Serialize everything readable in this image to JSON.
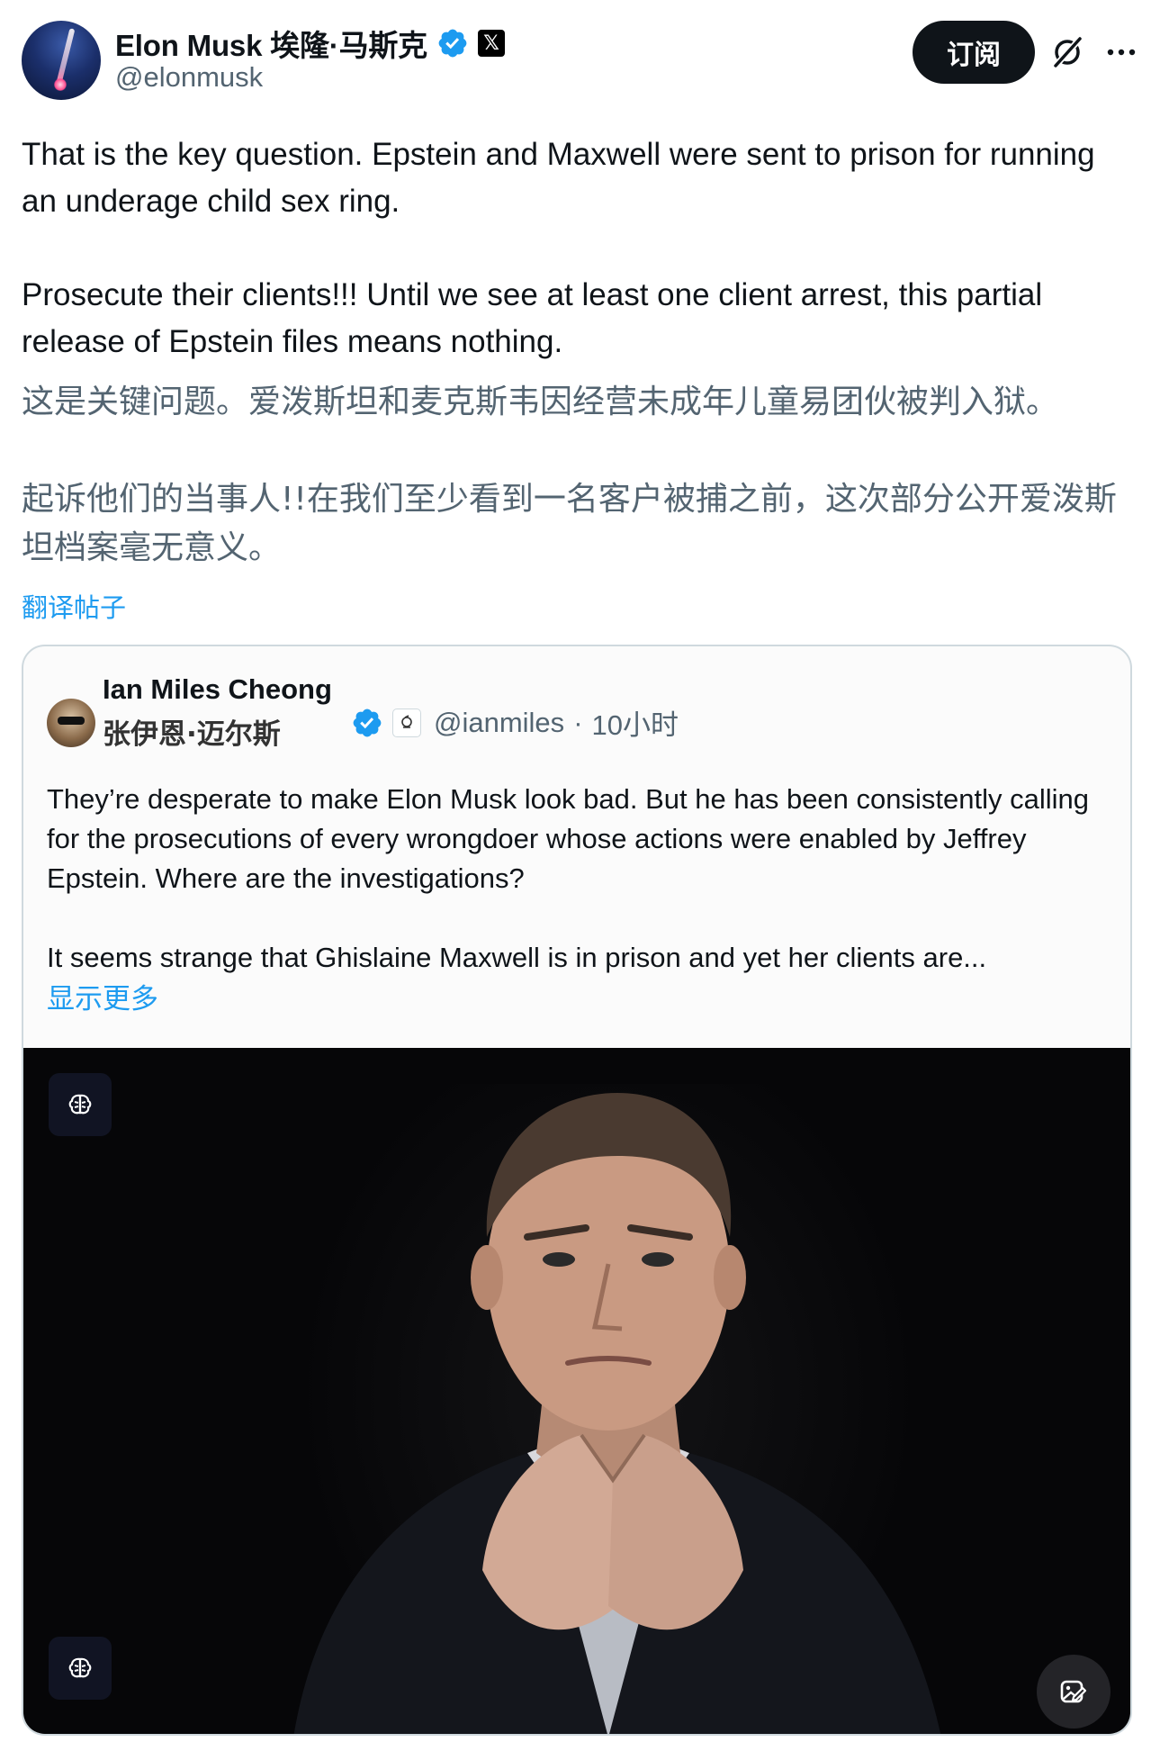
{
  "author": {
    "display_name": "Elon Musk 埃隆·马斯克",
    "handle": "@elonmusk",
    "x_badge": "𝕏"
  },
  "header": {
    "subscribe_label": "订阅"
  },
  "post": {
    "text": "That is the key question. Epstein and Maxwell were sent to prison for running an underage child sex ring.\n\nProsecute their clients!!! Until we see at least one client arrest, this partial release of Epstein files means nothing.",
    "translation": "这是关键问题。爱泼斯坦和麦克斯韦因经营未成年儿童易团伙被判入狱。\n\n起诉他们的当事人!!在我们至少看到一名客户被捕之前，这次部分公开爱泼斯坦档案毫无意义。",
    "translate_link": "翻译帖子"
  },
  "quote": {
    "display_name": "Ian Miles Cheong",
    "display_name_cn": "张伊恩·迈尔斯",
    "handle": "@ianmiles",
    "separator": "·",
    "time": "10小时",
    "text": "They’re desperate to make Elon Musk look bad. But he has been consistently calling for the prosecutions of every wrongdoer whose actions were enabled by Jeffrey Epstein. Where are the investigations?\n\nIt seems strange that Ghislaine Maxwell is in prison and yet her clients are...",
    "show_more": "显示更多"
  },
  "icons": {
    "verified": "verified-badge-icon",
    "grok": "grok-icon",
    "more": "more-icon",
    "media_badge": "brain-icon",
    "edit_image": "edit-image-icon"
  },
  "colors": {
    "accent": "#1d9bf0",
    "text": "#0f1419",
    "secondary": "#536471"
  }
}
